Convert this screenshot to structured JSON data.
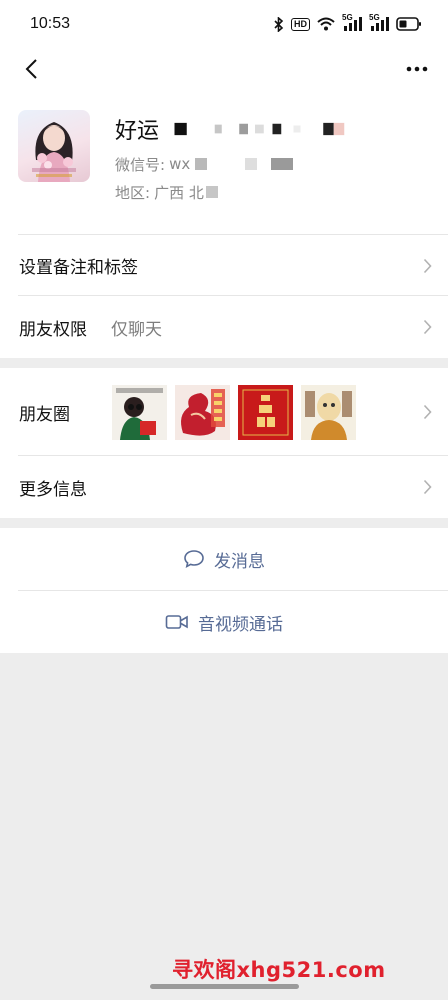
{
  "status_bar": {
    "time": "10:53",
    "hd_label": "HD",
    "net1": "5G",
    "net2": "5G"
  },
  "profile": {
    "nickname": "好运",
    "wechat_id_label": "微信号:",
    "wechat_id_value": "wx",
    "region_label": "地区:",
    "region_value": "广西  北"
  },
  "rows": {
    "remark_tags": "设置备注和标签",
    "permissions_label": "朋友权限",
    "permissions_value": "仅聊天",
    "moments_label": "朋友圈",
    "more_info": "更多信息"
  },
  "moments_thumbs": [
    {
      "name": "thumb-girl-red",
      "bg": "#f3f0ea"
    },
    {
      "name": "thumb-dragon",
      "bg": "#f5e9e4"
    },
    {
      "name": "thumb-red-calendar",
      "bg": "#c81a1a"
    },
    {
      "name": "thumb-monk",
      "bg": "#f4efe2"
    }
  ],
  "actions": {
    "message": "发消息",
    "video_call": "音视频通话"
  },
  "watermark": "寻欢阁xhg521.com",
  "colors": {
    "link": "#576b95",
    "background": "#ededed",
    "watermark": "#e0212e"
  }
}
